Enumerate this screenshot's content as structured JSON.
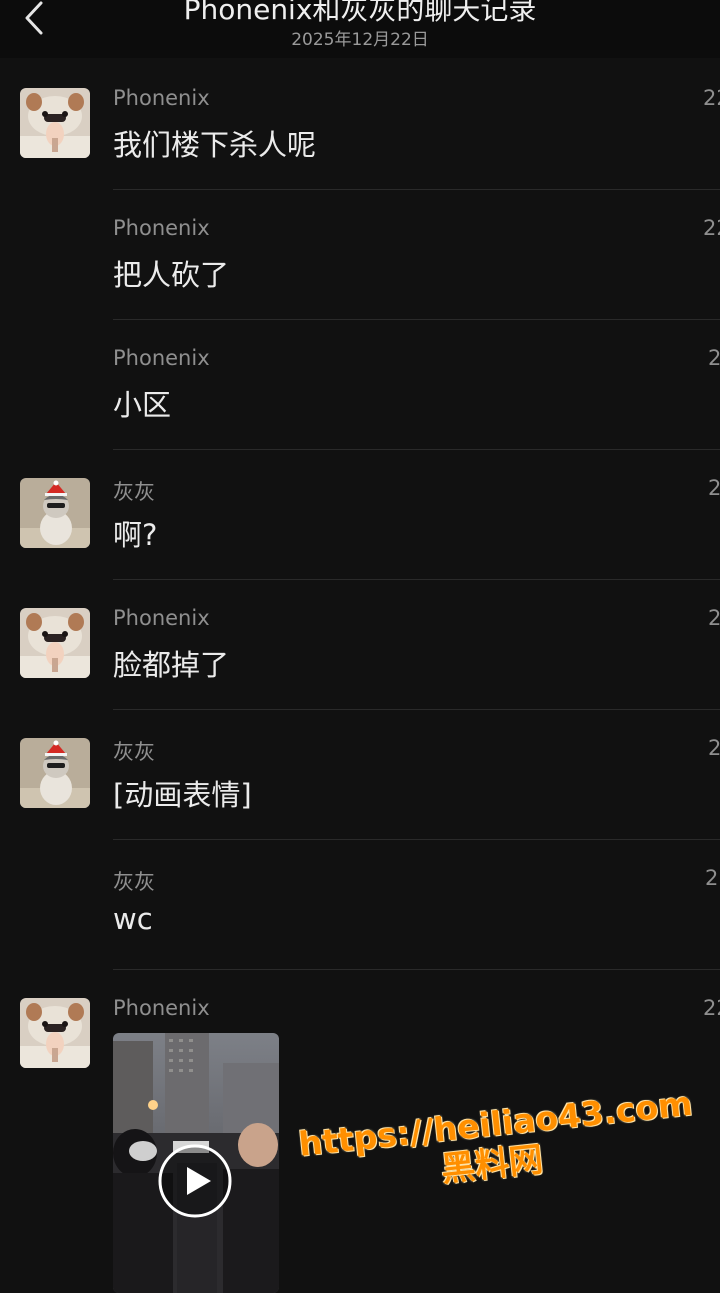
{
  "header": {
    "title": "Phonenix和灰灰的聊天记录",
    "date": "2025年12月22日"
  },
  "messages": [
    {
      "sender": "Phonenix",
      "text": "我们楼下杀人呢",
      "time": "22",
      "avatar": "phonenix-avatar"
    },
    {
      "sender": "Phonenix",
      "text": "把人砍了",
      "time": "22",
      "avatar": null
    },
    {
      "sender": "Phonenix",
      "text": "小区",
      "time": "2",
      "avatar": null
    },
    {
      "sender": "灰灰",
      "text": "啊?",
      "time": "2",
      "avatar": "huihui-avatar"
    },
    {
      "sender": "Phonenix",
      "text": "脸都掉了",
      "time": "2",
      "avatar": "phonenix-avatar"
    },
    {
      "sender": "灰灰",
      "text": "[动画表情]",
      "time": "2",
      "avatar": "huihui-avatar"
    },
    {
      "sender": "灰灰",
      "text": "wc",
      "time": "2:",
      "avatar": null
    },
    {
      "sender": "Phonenix",
      "text": "",
      "time": "22",
      "avatar": "phonenix-avatar",
      "attachment": "video"
    }
  ],
  "watermark": {
    "url": "https://heiliao43.com",
    "name": "黑料网"
  },
  "colors": {
    "background": "#111111",
    "header": "#0c0c0c",
    "text": "#ebebeb",
    "muted": "#8f8f8f",
    "watermark": "#ff8f00"
  },
  "icons": {
    "back": "chevron-left-icon",
    "play": "play-icon"
  }
}
